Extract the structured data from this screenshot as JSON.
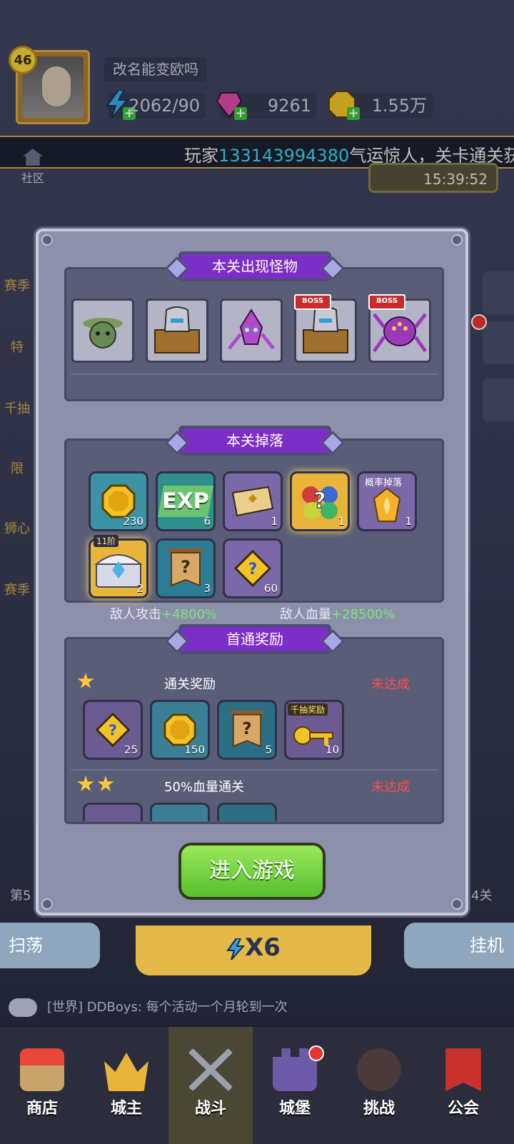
{
  "player": {
    "level": "46",
    "name": "改名能变欧吗",
    "energy": "2062/90",
    "gems": "9261",
    "gold": "1.55万"
  },
  "ticker": {
    "prefix": "玩家",
    "player_id": "133143994380",
    "suffix": "气运惊人，关卡通关获"
  },
  "community_label": "社区",
  "timer": "15:39:52",
  "side_left": [
    "赛季",
    "特",
    "千抽",
    "限",
    "狮心",
    "赛季"
  ],
  "modal": {
    "monsters_title": "本关出现怪物",
    "boss_tag": "BOSS",
    "enemy_attack_label": "敌人攻击",
    "enemy_attack_value": "+4800%",
    "enemy_hp_label": "敌人血量",
    "enemy_hp_value": "+28500%",
    "drops_title": "本关掉落",
    "drops": [
      {
        "icon": "gold-coin-icon",
        "count": "230"
      },
      {
        "icon": "exp-icon",
        "label": "EXP",
        "count": "6"
      },
      {
        "icon": "ticket-icon",
        "count": "1"
      },
      {
        "icon": "mystery-gems-icon",
        "count": "1"
      },
      {
        "icon": "flame-gem-icon",
        "tag": "概率掉落",
        "count": "1"
      },
      {
        "icon": "treasure-chest-icon",
        "tag": "11阶",
        "count": "2"
      },
      {
        "icon": "mystery-banner-icon",
        "count": "3"
      },
      {
        "icon": "puzzle-piece-icon",
        "count": "60"
      }
    ],
    "first_clear_title": "首通奖励",
    "reward_rows": [
      {
        "title": "通关奖励",
        "status": "未达成",
        "items": [
          {
            "icon": "puzzle-piece-icon",
            "count": "25"
          },
          {
            "icon": "gold-coin-icon",
            "count": "150"
          },
          {
            "icon": "mystery-banner-icon",
            "count": "5"
          },
          {
            "icon": "gold-key-icon",
            "tag": "千抽奖励",
            "count": "10"
          }
        ]
      },
      {
        "title": "50%血量通关",
        "status": "未达成"
      }
    ],
    "enter_button": "进入游戏"
  },
  "stage_left": "第5",
  "stage_right": "4关",
  "bottom": {
    "sweep": "扫荡",
    "speed": "X6",
    "idle": "挂机"
  },
  "chat": {
    "channel": "[世界]",
    "message": "DDBoys: 每个活动一个月轮到一次"
  },
  "nav": [
    {
      "label": "商店",
      "icon": "shop-icon"
    },
    {
      "label": "城主",
      "icon": "crown-icon"
    },
    {
      "label": "战斗",
      "icon": "crossed-swords-icon"
    },
    {
      "label": "城堡",
      "icon": "castle-icon"
    },
    {
      "label": "挑战",
      "icon": "demon-icon"
    },
    {
      "label": "公会",
      "icon": "guild-banner-icon"
    }
  ]
}
